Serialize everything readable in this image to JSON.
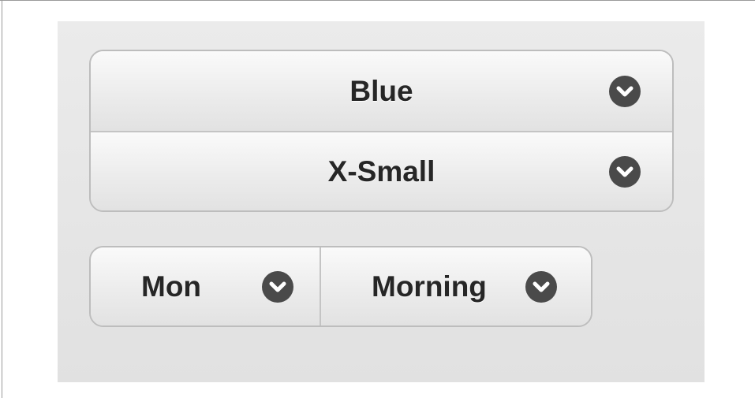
{
  "selects": {
    "color": {
      "value": "Blue",
      "icon": "chevron-down-icon"
    },
    "size": {
      "value": "X-Small",
      "icon": "chevron-down-icon"
    },
    "day": {
      "value": "Mon",
      "icon": "chevron-down-icon"
    },
    "time": {
      "value": "Morning",
      "icon": "chevron-down-icon"
    }
  },
  "colors": {
    "panel_background": "#e6e6e6",
    "button_text": "#262626",
    "icon_background": "#4a4a4a",
    "border": "#bdbdbd"
  }
}
